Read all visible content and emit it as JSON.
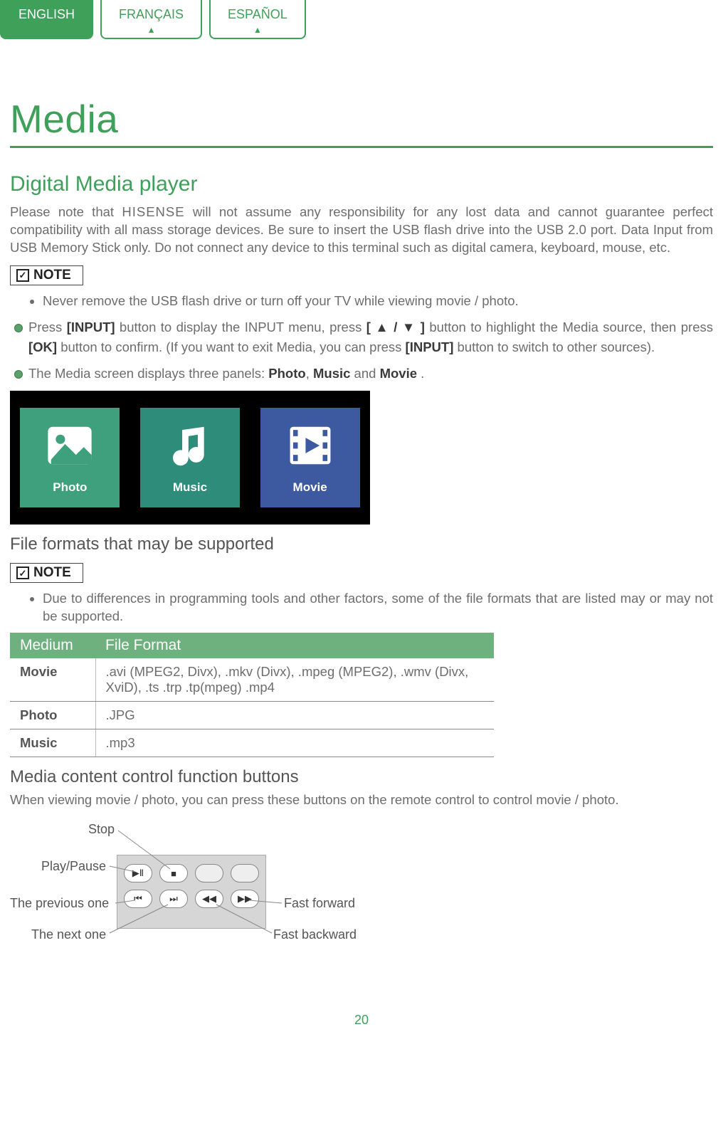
{
  "tabs": {
    "english": "ENGLISH",
    "francais": "FRANÇAIS",
    "espanol": "ESPAÑOL"
  },
  "title": "Media",
  "h2": "Digital Media player",
  "intro": {
    "pre": "Please note that ",
    "brand": "HISENSE",
    "post": " will not assume any responsibility for any lost data and cannot guarantee perfect compatibility with all mass storage devices. Be sure to insert the USB flash drive into the USB 2.0 port. Data Input from USB Memory Stick only. Do not connect any device to this terminal such as digital camera, keyboard, mouse, etc."
  },
  "note_label": "NOTE",
  "note1_items": [
    "Never remove the USB flash drive or turn off your TV while viewing movie / photo."
  ],
  "steps": {
    "item1": {
      "pre": "Press ",
      "b1": "[INPUT]",
      "mid1": " button to display the INPUT menu, press ",
      "b2": "[ ▲ / ▼ ]",
      "mid2": " button to highlight the Media  source, then press ",
      "b3": "[OK]",
      "mid3": " button to confirm. (If you want to exit Media, you can press ",
      "b4": "[INPUT]",
      "post": " button to switch to other sources)."
    },
    "item2": {
      "pre": "The Media screen displays three panels: ",
      "b1": "Photo",
      "c1": ", ",
      "b2": "Music",
      "c2": " and ",
      "b3": "Movie",
      "post": " ."
    }
  },
  "panels": {
    "photo": "Photo",
    "music": "Music",
    "movie": "Movie"
  },
  "h3_formats": "File formats that may be supported",
  "note2_items": [
    "Due to differences in programming tools and other factors, some of the file formats that are listed may or may not be supported."
  ],
  "table": {
    "head": {
      "medium": "Medium",
      "format": "File Format"
    },
    "rows": [
      {
        "medium": "Movie",
        "format": ".avi (MPEG2, Divx), .mkv (Divx), .mpeg (MPEG2), .wmv (Divx, XviD), .ts  .trp  .tp(mpeg)  .mp4"
      },
      {
        "medium": "Photo",
        "format": ".JPG"
      },
      {
        "medium": "Music",
        "format": ".mp3"
      }
    ]
  },
  "h3_buttons": "Media content control function buttons",
  "buttons_intro": "When viewing movie / photo, you can press these buttons on the remote control to control movie / photo.",
  "remote_labels": {
    "stop": "Stop",
    "playpause": "Play/Pause",
    "prev": "The previous one",
    "next": "The next one",
    "ff": "Fast forward",
    "fb": "Fast backward"
  },
  "page_number": "20"
}
